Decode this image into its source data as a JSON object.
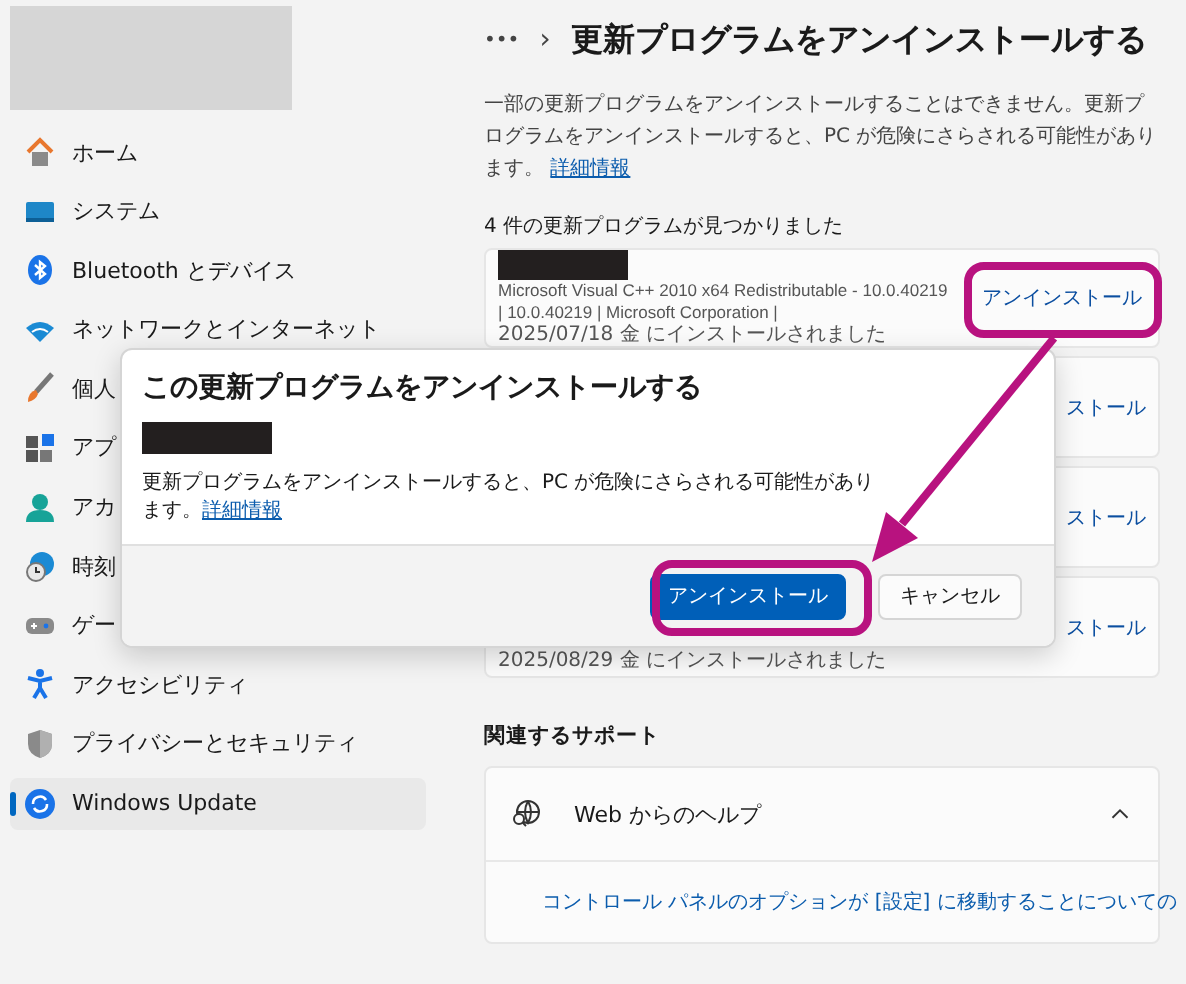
{
  "sidebar": {
    "items": [
      {
        "label": "ホーム",
        "selected": false
      },
      {
        "label": "システム",
        "selected": false
      },
      {
        "label": "Bluetooth とデバイス",
        "selected": false
      },
      {
        "label": "ネットワークとインターネット",
        "selected": false
      },
      {
        "label": "個人",
        "selected": false
      },
      {
        "label": "アプ",
        "selected": false
      },
      {
        "label": "アカ",
        "selected": false
      },
      {
        "label": "時刻",
        "selected": false
      },
      {
        "label": "ゲー",
        "selected": false
      },
      {
        "label": "アクセシビリティ",
        "selected": false
      },
      {
        "label": "プライバシーとセキュリティ",
        "selected": false
      },
      {
        "label": "Windows Update",
        "selected": true
      }
    ]
  },
  "header": {
    "overflow": "•••",
    "separator": "›",
    "title": "更新プログラムをアンインストールする"
  },
  "description": {
    "text": "一部の更新プログラムをアンインストールすることはできません。更新プログラムをアンインストールすると、PC が危険にさらされる可能性があります。",
    "link": "詳細情報"
  },
  "updates": {
    "count_label": "4 件の更新プログラムが見つかりました",
    "items": [
      {
        "name_redacted": true,
        "details": [
          "Microsoft Visual C++ 2010  x64 Redistributable - 10.0.40219",
          "|  10.0.40219  |  Microsoft Corporation  |",
          "2025/07/18 金 にインストールされました"
        ],
        "action": "アンインストール"
      },
      {
        "name_redacted": false,
        "action": "ストール"
      },
      {
        "name_redacted": false,
        "action": "ストール"
      },
      {
        "name_redacted": false,
        "details": [
          "2025/08/29 金 にインストールされました"
        ],
        "action": "ストール"
      }
    ]
  },
  "related_support": {
    "heading": "関連するサポート",
    "help": {
      "title": "Web からのヘルプ",
      "expanded": true,
      "links": [
        "コントロール パネルのオプションが [設定] に移動することについての"
      ]
    }
  },
  "dialog": {
    "title": "この更新プログラムをアンインストールする",
    "name_redacted": true,
    "message": "更新プログラムをアンインストールすると、PC が危険にさらされる可能性があります。",
    "link": "詳細情報",
    "buttons": [
      {
        "label": "アンインストール",
        "kind": "primary"
      },
      {
        "label": "キャンセル",
        "kind": "secondary"
      }
    ]
  }
}
